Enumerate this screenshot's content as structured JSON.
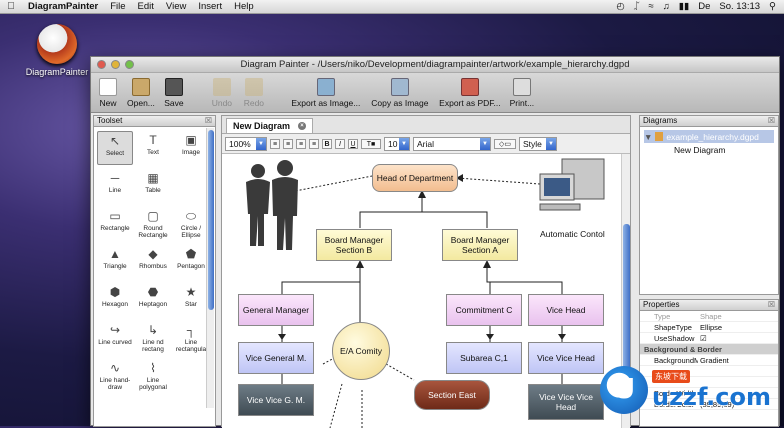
{
  "menubar": {
    "apple": "",
    "app": "DiagramPainter",
    "items": [
      "File",
      "Edit",
      "View",
      "Insert",
      "Help"
    ],
    "lang": "De",
    "clock": "So. 13:13"
  },
  "desktop_icon": {
    "label": "DiagramPainter"
  },
  "window": {
    "title": "Diagram Painter - /Users/niko/Development/diagrampainter/artwork/example_hierarchy.dgpd"
  },
  "toolbar": {
    "new": "New",
    "open": "Open...",
    "save": "Save",
    "undo": "Undo",
    "redo": "Redo",
    "export_image": "Export as Image...",
    "copy_image": "Copy as Image",
    "export_pdf": "Export as PDF...",
    "print": "Print..."
  },
  "toolset": {
    "title": "Toolset",
    "tools": [
      "Select",
      "Text",
      "Image",
      "Line",
      "Table",
      "",
      "Rectangle",
      "Round Rectangle",
      "Circle / Ellipse",
      "Triangle",
      "Rhombus",
      "Pentagon",
      "Hexagon",
      "Heptagon",
      "Star",
      "Line curved",
      "Line nd rectang",
      "Line rectangula",
      "Line hand-draw",
      "Line polygonal",
      ""
    ]
  },
  "editor": {
    "tab": "New Diagram",
    "zoom": "100%",
    "font_size": "10",
    "font": "Arial",
    "style": "Style"
  },
  "diagram": {
    "head": "Head of Department",
    "board_b": "Board Manager Section B",
    "board_a": "Board Manager Section A",
    "auto_control": "Automatic Contol",
    "gm": "General Manager",
    "vgm": "Vice General M.",
    "vvgm": "Vice Vice G. M.",
    "ea": "E/A Comity",
    "commit": "Commitment C",
    "subarea": "Subarea C,1",
    "vicehead": "Vice Head",
    "vvhead": "Vice Vice Head",
    "vvvhead": "Vice Vice Vice Head",
    "east": "Section East"
  },
  "diagrams_panel": {
    "title": "Diagrams",
    "file": "example_hierarchy.dgpd",
    "item": "New Diagram"
  },
  "properties": {
    "title": "Properties",
    "header_k": "Type",
    "header_v": "Shape",
    "rows": [
      {
        "k": "ShapeType",
        "v": "Ellipse"
      },
      {
        "k": "UseShadow",
        "v": "☑"
      }
    ],
    "group": "Background & Border",
    "rows2": [
      {
        "k": "BackgroundMod",
        "v": "Gradient"
      },
      {
        "k": "",
        "v": ""
      },
      {
        "k": "",
        "v": ""
      },
      {
        "k": "BorderWidth",
        "v": "1"
      },
      {
        "k": "BorderColor",
        "v": "(89,89,89)"
      }
    ]
  },
  "watermark": {
    "text": "uzzf.com",
    "badge": "东坡下载"
  }
}
